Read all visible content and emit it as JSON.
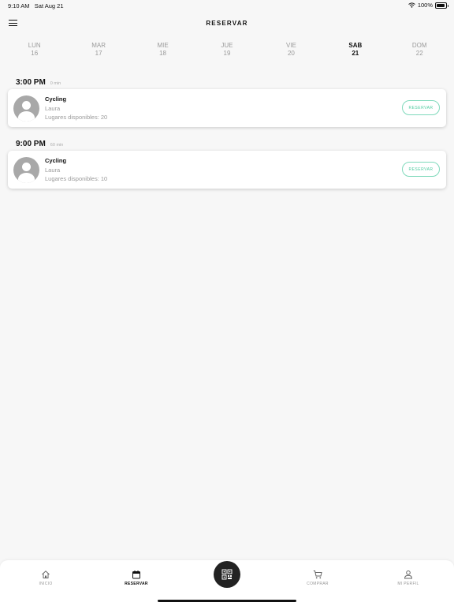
{
  "status_bar": {
    "time": "9:10 AM",
    "date": "Sat Aug 21",
    "battery": "100%"
  },
  "header": {
    "title": "RESERVAR"
  },
  "days": [
    {
      "name": "LUN",
      "number": "16",
      "selected": false
    },
    {
      "name": "MAR",
      "number": "17",
      "selected": false
    },
    {
      "name": "MIE",
      "number": "18",
      "selected": false
    },
    {
      "name": "JUE",
      "number": "19",
      "selected": false
    },
    {
      "name": "VIE",
      "number": "20",
      "selected": false
    },
    {
      "name": "SAB",
      "number": "21",
      "selected": true
    },
    {
      "name": "DOM",
      "number": "22",
      "selected": false
    }
  ],
  "slots": [
    {
      "time": "3:00 PM",
      "duration": "0 min",
      "class_name": "Cycling",
      "instructor": "Laura",
      "spots": "Lugares disponibles: 20",
      "button_label": "RESERVAR"
    },
    {
      "time": "9:00 PM",
      "duration": "60 min",
      "class_name": "Cycling",
      "instructor": "Laura",
      "spots": "Lugares disponibles: 10",
      "button_label": "RESERVAR"
    }
  ],
  "tabs": [
    {
      "label": "INICIO",
      "icon": "home-icon",
      "active": false
    },
    {
      "label": "RESERVAR",
      "icon": "calendar-icon",
      "active": true
    },
    {
      "label": "COMPRAR",
      "icon": "cart-icon",
      "active": false
    },
    {
      "label": "MI PERFIL",
      "icon": "profile-icon",
      "active": false
    }
  ],
  "center_action": {
    "icon": "qr-code-icon"
  },
  "colors": {
    "accent": "#4ecb9f",
    "background": "#f7f7f7",
    "dark": "#222222"
  }
}
